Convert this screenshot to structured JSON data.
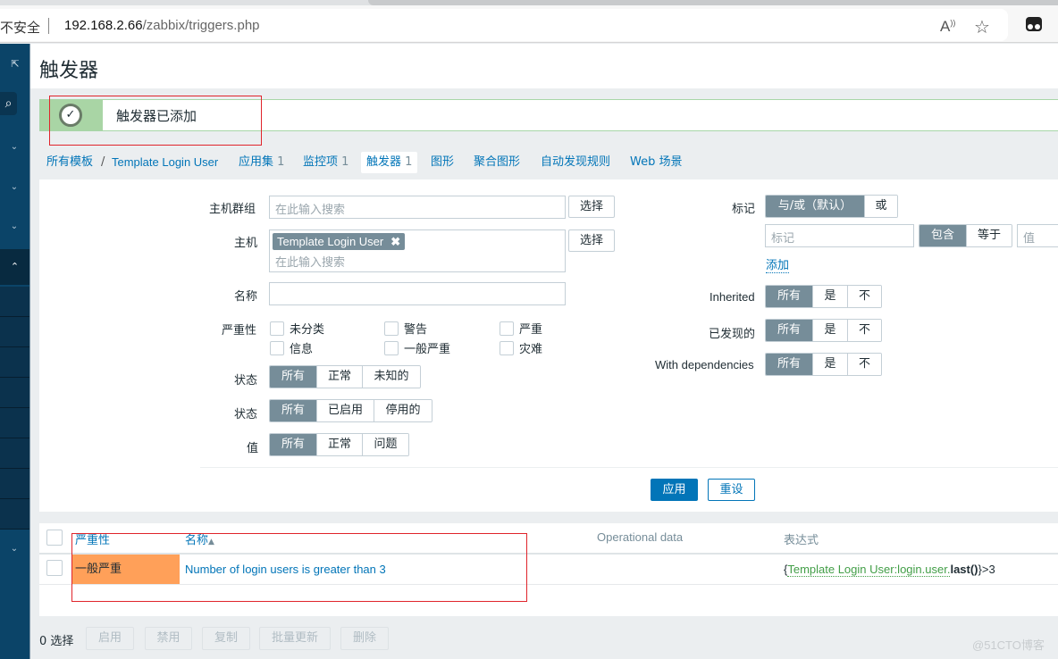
{
  "browser": {
    "security_label": "不安全",
    "url_host": "192.168.2.66",
    "url_path": "/zabbix/triggers.php",
    "read_aloud_icon": "A))",
    "favorite_icon": "☆"
  },
  "page": {
    "title": "触发器"
  },
  "message": {
    "text": "触发器已添加",
    "icon": "✓",
    "type": "success"
  },
  "breadcrumb": {
    "root": "所有模板",
    "separator": "/",
    "host": "Template Login User"
  },
  "nav_tabs": [
    {
      "label": "应用集",
      "count": "1"
    },
    {
      "label": "监控项",
      "count": "1"
    },
    {
      "label": "触发器",
      "count": "1",
      "active": true
    },
    {
      "label": "图形"
    },
    {
      "label": "聚合图形"
    },
    {
      "label": "自动发现规则"
    },
    {
      "label": "Web 场景"
    }
  ],
  "filter": {
    "host_group": {
      "label": "主机群组",
      "placeholder": "在此输入搜索",
      "select_label": "选择"
    },
    "host": {
      "label": "主机",
      "chip": "Template Login User",
      "chip_remove": "✖",
      "placeholder": "在此输入搜索",
      "select_label": "选择"
    },
    "name": {
      "label": "名称",
      "value": ""
    },
    "severity": {
      "label": "严重性",
      "options": [
        "未分类",
        "警告",
        "严重",
        "信息",
        "一般严重",
        "灾难"
      ]
    },
    "state": {
      "label": "状态",
      "options": [
        "所有",
        "正常",
        "未知的"
      ],
      "selected": "所有"
    },
    "status": {
      "label": "状态",
      "options": [
        "所有",
        "已启用",
        "停用的"
      ],
      "selected": "所有"
    },
    "value": {
      "label": "值",
      "options": [
        "所有",
        "正常",
        "问题"
      ],
      "selected": "所有"
    },
    "tags": {
      "label": "标记",
      "operator_options": [
        "与/或（默认）",
        "或"
      ],
      "operator_selected": "与/或（默认）",
      "tag_placeholder": "标记",
      "match_options": [
        "包含",
        "等于"
      ],
      "match_selected": "包含",
      "value_placeholder": "值",
      "add_label": "添加"
    },
    "inherited": {
      "label": "Inherited",
      "options": [
        "所有",
        "是",
        "不"
      ],
      "selected": "所有"
    },
    "discovered": {
      "label": "已发现的",
      "options": [
        "所有",
        "是",
        "不"
      ],
      "selected": "所有"
    },
    "dependencies": {
      "label": "With dependencies",
      "options": [
        "所有",
        "是",
        "不"
      ],
      "selected": "所有"
    },
    "apply_label": "应用",
    "reset_label": "重设"
  },
  "table": {
    "columns": [
      "严重性",
      "名称",
      "Operational data",
      "表达式"
    ],
    "sort_indicator": "▲",
    "rows": [
      {
        "severity": "一般严重",
        "severity_color": "#ffa059",
        "name": "Number of login users is greater than 3",
        "operational_data": "",
        "expression_open": "{",
        "expression_item": "Template Login User:login.user.",
        "expression_func": "last()",
        "expression_close": "}>3"
      }
    ]
  },
  "footer": {
    "selected_count": "0 选择",
    "buttons": [
      "启用",
      "禁用",
      "复制",
      "批量更新",
      "删除"
    ]
  },
  "watermark": "@51CTO博客",
  "colors": {
    "accent": "#0275b8",
    "sidebar": "#0b4468",
    "segment_on": "#768d99",
    "success": "#a9d5a5",
    "severity_average": "#ffa059"
  }
}
